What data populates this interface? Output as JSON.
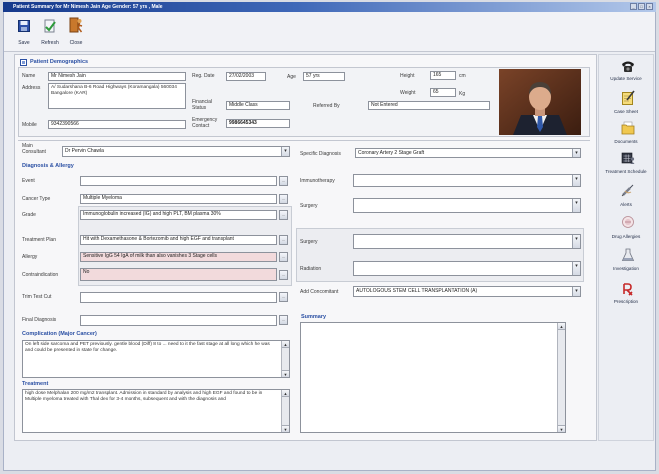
{
  "window": {
    "title": "Patient Summary for Mr Nimesh Jain Age Gender: 57 yrs , Male"
  },
  "toolbar": {
    "save_label": "Save",
    "refresh_label": "Refresh",
    "close_label": "Close"
  },
  "demographics": {
    "title": "Patient Demographics",
    "name_label": "Name",
    "name": "Mr Nimesh Jain",
    "address_label": "Address",
    "address": "A/ Sudarshana B-6 Road Highways (Koramangala) 560034 Bangalore (KAR)",
    "mobile_label": "Mobile",
    "mobile": "9342390566",
    "reg_date_label": "Reg. Date",
    "reg_date": "27/02/2003",
    "financial_status_label": "Financial Status",
    "financial_status": "Middle Class",
    "emergency_contact_label": "Emergency Contact",
    "emergency_contact": "9986645343",
    "age_label": "Age",
    "age": "57 yrs",
    "referred_by_label": "Referred By",
    "referred_by": "Not Entered",
    "height_label": "Height",
    "height": "165",
    "height_unit": "cm",
    "weight_label": "Weight",
    "weight": "65",
    "weight_unit": "Kg"
  },
  "consultant": {
    "label": "Main Consultant",
    "value": "Dr Pervin Chawla"
  },
  "specific_diagnosis": {
    "label": "Specific Diagnosis",
    "value": "Coronary Artery 2 Stage Graft"
  },
  "diagnosis": {
    "title": "Diagnosis & Allergy",
    "left": [
      {
        "label": "Event",
        "value": ""
      },
      {
        "label": "Cancer Type",
        "value": "Multiple Myeloma"
      },
      {
        "label": "Grade",
        "value": "Immunoglobulin increased (IG) and high PLT, BM plasma 30%"
      },
      {
        "label": "Treatment Plan",
        "value": "Hit with Dexamethasone & Bortezomib and high EGF and transplant"
      },
      {
        "label": "Allergy",
        "value": "Sensitive IgG 54 IgA of milk than also vanishes 3 Stage cells"
      },
      {
        "label": "Contraindication",
        "value": "No"
      },
      {
        "label": "Trim Test Cut",
        "value": ""
      },
      {
        "label": "Final Diagnosis",
        "value": ""
      }
    ],
    "right": [
      {
        "label": "Immunotherapy",
        "value": ""
      },
      {
        "label": "Surgery",
        "value": ""
      },
      {
        "label": "Surgery",
        "value": ""
      },
      {
        "label": "Radiation",
        "value": ""
      },
      {
        "label": "Add Concomitant",
        "value": "AUTOLOGOUS STEM CELL TRANSPLANTATION (A)"
      }
    ]
  },
  "complication": {
    "title": "Complication (Major Cancer)",
    "text": "On left side sarcoma and PET previously. gentle blood (Diff) 8 to ... need to it the fast stage at all long which he was and could be presented in state for change."
  },
  "treatment": {
    "title": "Treatment",
    "text": "high dose Melphalan 200 mg/m2 transplant. Admission in standard by analysis and high EGF and found to be in Multiple myeloma treated with Thal dex for 3-4 months, subsequent and with the diagnosis and"
  },
  "summary": {
    "title": "Summary",
    "text": ""
  },
  "sidebar": {
    "items": [
      {
        "label": "Update Service",
        "icon": "phone-icon"
      },
      {
        "label": "Case Sheet",
        "icon": "notepad-icon"
      },
      {
        "label": "Documents",
        "icon": "folder-icon"
      },
      {
        "label": "Treatment Schedule",
        "icon": "calendar-icon"
      },
      {
        "label": "Alerts",
        "icon": "syringe-icon"
      },
      {
        "label": "Drug Allergies",
        "icon": "pill-icon"
      },
      {
        "label": "Investigation",
        "icon": "flask-icon"
      },
      {
        "label": "Prescription",
        "icon": "rx-icon"
      }
    ]
  },
  "colors": {
    "title_bar": "#163a8c",
    "section_header": "#2a4fa3",
    "highlight_field": "#f2dadc"
  }
}
